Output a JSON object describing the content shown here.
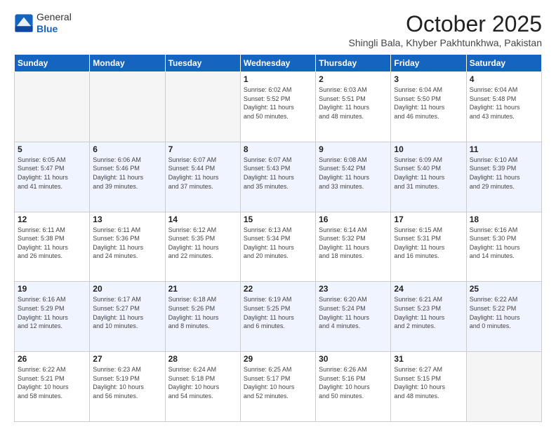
{
  "header": {
    "logo_general": "General",
    "logo_blue": "Blue",
    "month_title": "October 2025",
    "location": "Shingli Bala, Khyber Pakhtunkhwa, Pakistan"
  },
  "days_of_week": [
    "Sunday",
    "Monday",
    "Tuesday",
    "Wednesday",
    "Thursday",
    "Friday",
    "Saturday"
  ],
  "weeks": [
    [
      {
        "day": "",
        "info": ""
      },
      {
        "day": "",
        "info": ""
      },
      {
        "day": "",
        "info": ""
      },
      {
        "day": "1",
        "info": "Sunrise: 6:02 AM\nSunset: 5:52 PM\nDaylight: 11 hours\nand 50 minutes."
      },
      {
        "day": "2",
        "info": "Sunrise: 6:03 AM\nSunset: 5:51 PM\nDaylight: 11 hours\nand 48 minutes."
      },
      {
        "day": "3",
        "info": "Sunrise: 6:04 AM\nSunset: 5:50 PM\nDaylight: 11 hours\nand 46 minutes."
      },
      {
        "day": "4",
        "info": "Sunrise: 6:04 AM\nSunset: 5:48 PM\nDaylight: 11 hours\nand 43 minutes."
      }
    ],
    [
      {
        "day": "5",
        "info": "Sunrise: 6:05 AM\nSunset: 5:47 PM\nDaylight: 11 hours\nand 41 minutes."
      },
      {
        "day": "6",
        "info": "Sunrise: 6:06 AM\nSunset: 5:46 PM\nDaylight: 11 hours\nand 39 minutes."
      },
      {
        "day": "7",
        "info": "Sunrise: 6:07 AM\nSunset: 5:44 PM\nDaylight: 11 hours\nand 37 minutes."
      },
      {
        "day": "8",
        "info": "Sunrise: 6:07 AM\nSunset: 5:43 PM\nDaylight: 11 hours\nand 35 minutes."
      },
      {
        "day": "9",
        "info": "Sunrise: 6:08 AM\nSunset: 5:42 PM\nDaylight: 11 hours\nand 33 minutes."
      },
      {
        "day": "10",
        "info": "Sunrise: 6:09 AM\nSunset: 5:40 PM\nDaylight: 11 hours\nand 31 minutes."
      },
      {
        "day": "11",
        "info": "Sunrise: 6:10 AM\nSunset: 5:39 PM\nDaylight: 11 hours\nand 29 minutes."
      }
    ],
    [
      {
        "day": "12",
        "info": "Sunrise: 6:11 AM\nSunset: 5:38 PM\nDaylight: 11 hours\nand 26 minutes."
      },
      {
        "day": "13",
        "info": "Sunrise: 6:11 AM\nSunset: 5:36 PM\nDaylight: 11 hours\nand 24 minutes."
      },
      {
        "day": "14",
        "info": "Sunrise: 6:12 AM\nSunset: 5:35 PM\nDaylight: 11 hours\nand 22 minutes."
      },
      {
        "day": "15",
        "info": "Sunrise: 6:13 AM\nSunset: 5:34 PM\nDaylight: 11 hours\nand 20 minutes."
      },
      {
        "day": "16",
        "info": "Sunrise: 6:14 AM\nSunset: 5:32 PM\nDaylight: 11 hours\nand 18 minutes."
      },
      {
        "day": "17",
        "info": "Sunrise: 6:15 AM\nSunset: 5:31 PM\nDaylight: 11 hours\nand 16 minutes."
      },
      {
        "day": "18",
        "info": "Sunrise: 6:16 AM\nSunset: 5:30 PM\nDaylight: 11 hours\nand 14 minutes."
      }
    ],
    [
      {
        "day": "19",
        "info": "Sunrise: 6:16 AM\nSunset: 5:29 PM\nDaylight: 11 hours\nand 12 minutes."
      },
      {
        "day": "20",
        "info": "Sunrise: 6:17 AM\nSunset: 5:27 PM\nDaylight: 11 hours\nand 10 minutes."
      },
      {
        "day": "21",
        "info": "Sunrise: 6:18 AM\nSunset: 5:26 PM\nDaylight: 11 hours\nand 8 minutes."
      },
      {
        "day": "22",
        "info": "Sunrise: 6:19 AM\nSunset: 5:25 PM\nDaylight: 11 hours\nand 6 minutes."
      },
      {
        "day": "23",
        "info": "Sunrise: 6:20 AM\nSunset: 5:24 PM\nDaylight: 11 hours\nand 4 minutes."
      },
      {
        "day": "24",
        "info": "Sunrise: 6:21 AM\nSunset: 5:23 PM\nDaylight: 11 hours\nand 2 minutes."
      },
      {
        "day": "25",
        "info": "Sunrise: 6:22 AM\nSunset: 5:22 PM\nDaylight: 11 hours\nand 0 minutes."
      }
    ],
    [
      {
        "day": "26",
        "info": "Sunrise: 6:22 AM\nSunset: 5:21 PM\nDaylight: 10 hours\nand 58 minutes."
      },
      {
        "day": "27",
        "info": "Sunrise: 6:23 AM\nSunset: 5:19 PM\nDaylight: 10 hours\nand 56 minutes."
      },
      {
        "day": "28",
        "info": "Sunrise: 6:24 AM\nSunset: 5:18 PM\nDaylight: 10 hours\nand 54 minutes."
      },
      {
        "day": "29",
        "info": "Sunrise: 6:25 AM\nSunset: 5:17 PM\nDaylight: 10 hours\nand 52 minutes."
      },
      {
        "day": "30",
        "info": "Sunrise: 6:26 AM\nSunset: 5:16 PM\nDaylight: 10 hours\nand 50 minutes."
      },
      {
        "day": "31",
        "info": "Sunrise: 6:27 AM\nSunset: 5:15 PM\nDaylight: 10 hours\nand 48 minutes."
      },
      {
        "day": "",
        "info": ""
      }
    ]
  ]
}
